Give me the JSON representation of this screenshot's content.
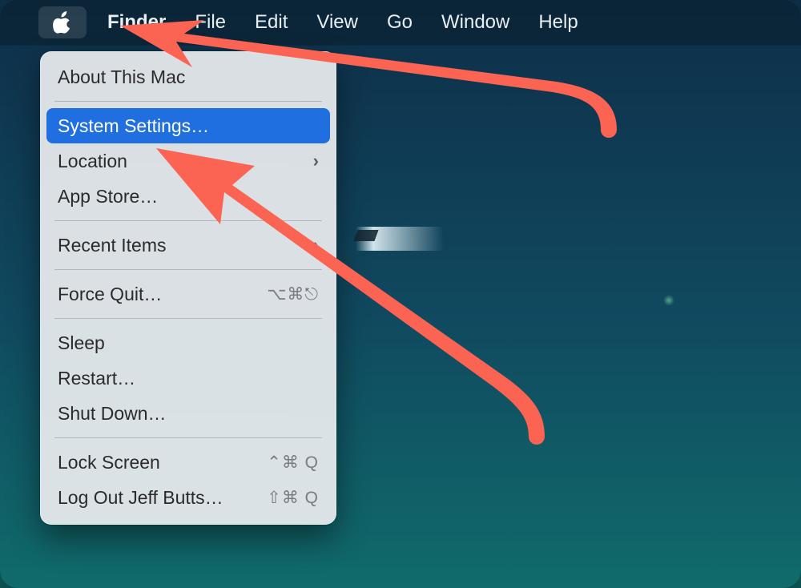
{
  "menubar": {
    "app_name": "Finder",
    "items": [
      "File",
      "Edit",
      "View",
      "Go",
      "Window",
      "Help"
    ]
  },
  "apple_menu": {
    "about": "About This Mac",
    "system_settings": "System Settings…",
    "location": "Location",
    "app_store": "App Store…",
    "recent_items": "Recent Items",
    "force_quit": "Force Quit…",
    "force_quit_shortcut": "⌥⌘⎋",
    "sleep": "Sleep",
    "restart": "Restart…",
    "shut_down": "Shut Down…",
    "lock_screen": "Lock Screen",
    "lock_screen_shortcut": "⌃⌘ Q",
    "log_out": "Log Out Jeff Butts…",
    "log_out_shortcut": "⇧⌘ Q"
  }
}
